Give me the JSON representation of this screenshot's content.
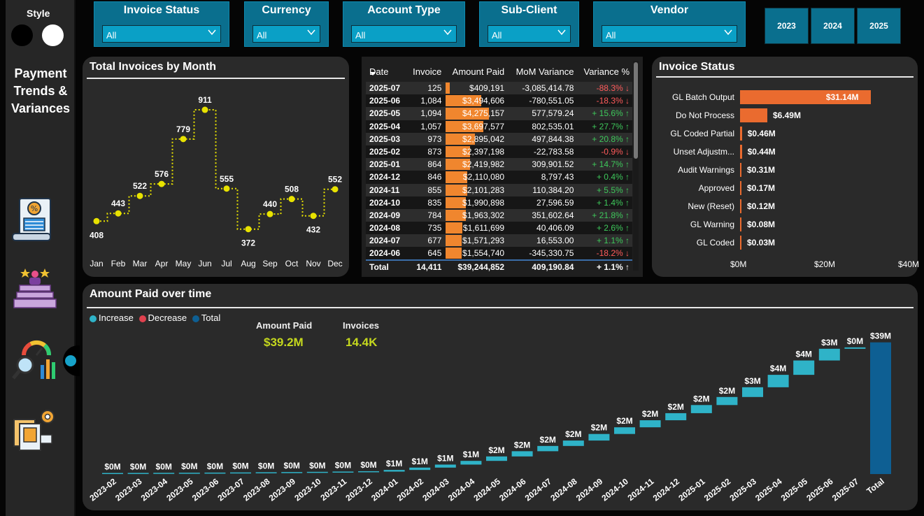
{
  "sidebar": {
    "style_label": "Style",
    "title_lines": [
      "Payment",
      "Trends &",
      "Variances"
    ]
  },
  "filters": [
    {
      "label": "Invoice Status",
      "value": "All"
    },
    {
      "label": "Currency",
      "value": "All"
    },
    {
      "label": "Account Type",
      "value": "All"
    },
    {
      "label": "Sub-Client",
      "value": "All"
    },
    {
      "label": "Vendor",
      "value": "All"
    }
  ],
  "years": [
    "2023",
    "2024",
    "2025"
  ],
  "monthly_chart": {
    "title": "Total Invoices by Month",
    "chart_data": {
      "type": "line",
      "categories": [
        "Jan",
        "Feb",
        "Mar",
        "Apr",
        "May",
        "Jun",
        "Jul",
        "Aug",
        "Sep",
        "Oct",
        "Nov",
        "Dec"
      ],
      "values": [
        408,
        443,
        522,
        576,
        779,
        911,
        555,
        372,
        440,
        508,
        432,
        552
      ],
      "step": true,
      "color": "#e8e200"
    }
  },
  "table": {
    "headers": [
      "Date",
      "Invoice",
      "Amount Paid",
      "MoM Variance",
      "Variance %"
    ],
    "rows": [
      {
        "date": "2025-07",
        "invoice": "125",
        "amount": "$409,191",
        "amount_value": 409191,
        "mom": "-3,085,414.78",
        "var": "-88.3% ↓",
        "dir": "neg"
      },
      {
        "date": "2025-06",
        "invoice": "1,084",
        "amount": "$3,494,606",
        "amount_value": 3494606,
        "mom": "-780,551.05",
        "var": "-18.3% ↓",
        "dir": "neg"
      },
      {
        "date": "2025-05",
        "invoice": "1,094",
        "amount": "$4,275,157",
        "amount_value": 4275157,
        "mom": "577,579.24",
        "var": "+ 15.6% ↑",
        "dir": "pos"
      },
      {
        "date": "2025-04",
        "invoice": "1,057",
        "amount": "$3,697,577",
        "amount_value": 3697577,
        "mom": "802,535.01",
        "var": "+ 27.7% ↑",
        "dir": "pos"
      },
      {
        "date": "2025-03",
        "invoice": "973",
        "amount": "$2,895,042",
        "amount_value": 2895042,
        "mom": "497,844.38",
        "var": "+ 20.8% ↑",
        "dir": "pos"
      },
      {
        "date": "2025-02",
        "invoice": "873",
        "amount": "$2,397,198",
        "amount_value": 2397198,
        "mom": "-22,783.58",
        "var": "-0.9% ↓",
        "dir": "neg"
      },
      {
        "date": "2025-01",
        "invoice": "864",
        "amount": "$2,419,982",
        "amount_value": 2419982,
        "mom": "309,901.52",
        "var": "+ 14.7% ↑",
        "dir": "pos"
      },
      {
        "date": "2024-12",
        "invoice": "846",
        "amount": "$2,110,080",
        "amount_value": 2110080,
        "mom": "8,797.43",
        "var": "+ 0.4% ↑",
        "dir": "pos"
      },
      {
        "date": "2024-11",
        "invoice": "855",
        "amount": "$2,101,283",
        "amount_value": 2101283,
        "mom": "110,384.20",
        "var": "+ 5.5% ↑",
        "dir": "pos"
      },
      {
        "date": "2024-10",
        "invoice": "835",
        "amount": "$1,990,898",
        "amount_value": 1990898,
        "mom": "27,596.59",
        "var": "+ 1.4% ↑",
        "dir": "pos"
      },
      {
        "date": "2024-09",
        "invoice": "784",
        "amount": "$1,963,302",
        "amount_value": 1963302,
        "mom": "351,602.64",
        "var": "+ 21.8% ↑",
        "dir": "pos"
      },
      {
        "date": "2024-08",
        "invoice": "735",
        "amount": "$1,611,699",
        "amount_value": 1611699,
        "mom": "40,406.09",
        "var": "+ 2.6% ↑",
        "dir": "pos"
      },
      {
        "date": "2024-07",
        "invoice": "677",
        "amount": "$1,571,293",
        "amount_value": 1571293,
        "mom": "16,553.00",
        "var": "+ 1.1% ↑",
        "dir": "pos"
      },
      {
        "date": "2024-06",
        "invoice": "645",
        "amount": "$1,554,740",
        "amount_value": 1554740,
        "mom": "-345,330.75",
        "var": "-18.2% ↓",
        "dir": "neg"
      }
    ],
    "total": {
      "date": "Total",
      "invoice": "14,411",
      "amount": "$39,244,852",
      "mom": "409,190.84",
      "var": "+ 1.1% ↑"
    }
  },
  "status_chart": {
    "title": "Invoice Status",
    "chart_data": {
      "type": "bar",
      "orientation": "horizontal",
      "categories": [
        "GL Batch Output",
        "Do Not Process",
        "GL Coded Partial",
        "Unset Adjustm...",
        "Audit Warnings",
        "Approved",
        "New (Reset)",
        "GL Warning",
        "GL Coded"
      ],
      "values": [
        31.14,
        6.49,
        0.46,
        0.44,
        0.31,
        0.17,
        0.12,
        0.08,
        0.03
      ],
      "labels": [
        "$31.14M",
        "$6.49M",
        "$0.46M",
        "$0.44M",
        "$0.31M",
        "$0.17M",
        "$0.12M",
        "$0.08M",
        "$0.03M"
      ],
      "xlim": [
        0,
        40
      ],
      "xticks": [
        "$0M",
        "$20M",
        "$40M"
      ],
      "color": "#ea6b2f"
    }
  },
  "waterfall": {
    "title": "Amount Paid over time",
    "legend": [
      {
        "label": "Increase",
        "color": "#2fb3c8"
      },
      {
        "label": "Decrease",
        "color": "#e0414e"
      },
      {
        "label": "Total",
        "color": "#0e5f93"
      }
    ],
    "kpis": [
      {
        "label": "Amount Paid",
        "value": "$39.2M"
      },
      {
        "label": "Invoices",
        "value": "14.4K"
      }
    ],
    "chart_data": {
      "type": "bar",
      "subtype": "waterfall",
      "categories": [
        "2023-02",
        "2023-03",
        "2023-04",
        "2023-05",
        "2023-06",
        "2023-07",
        "2023-08",
        "2023-09",
        "2023-10",
        "2023-11",
        "2023-12",
        "2024-01",
        "2024-02",
        "2024-03",
        "2024-04",
        "2024-05",
        "2024-06",
        "2024-07",
        "2024-08",
        "2024-09",
        "2024-10",
        "2024-11",
        "2024-12",
        "2025-01",
        "2025-02",
        "2025-03",
        "2025-04",
        "2025-05",
        "2025-06",
        "2025-07",
        "Total"
      ],
      "labels": [
        "$0M",
        "$0M",
        "$0M",
        "$0M",
        "$0M",
        "$0M",
        "$0M",
        "$0M",
        "$0M",
        "$0M",
        "$0M",
        "$1M",
        "$1M",
        "$1M",
        "$1M",
        "$2M",
        "$2M",
        "$2M",
        "$2M",
        "$2M",
        "$2M",
        "$2M",
        "$2M",
        "$2M",
        "$2M",
        "$3M",
        "$4M",
        "$4M",
        "$3M",
        "$0M",
        "$39M"
      ],
      "values": [
        0.02,
        0.03,
        0.03,
        0.04,
        0.05,
        0.05,
        0.06,
        0.07,
        0.08,
        0.1,
        0.2,
        0.49,
        0.7,
        0.9,
        1.1,
        1.33,
        1.55,
        1.57,
        1.61,
        1.96,
        1.99,
        2.1,
        2.11,
        2.42,
        2.4,
        2.9,
        3.7,
        4.28,
        3.49,
        0.41,
        39.24
      ],
      "total": 39.24,
      "ylim": [
        0,
        40
      ]
    }
  }
}
